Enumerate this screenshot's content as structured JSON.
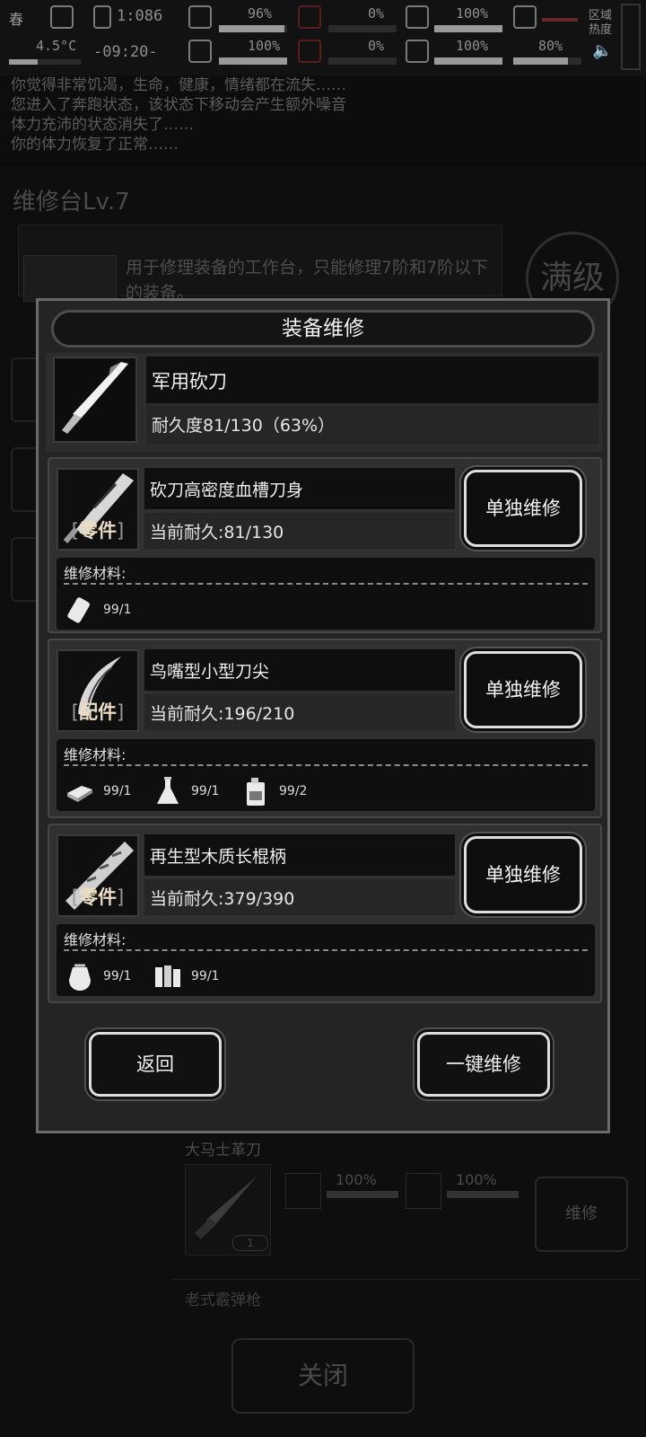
{
  "status_bar": {
    "season": "春",
    "time": "1:086",
    "temperature": "4.5°C",
    "clock": "-09:20-",
    "stat_pcts": [
      "96%",
      "0%",
      "100%",
      "100%",
      "0%",
      "100%",
      "80%"
    ],
    "region_heat_label": "区域热度"
  },
  "log": {
    "lines": [
      "你觉得非常饥渴，生命，健康，情绪都在流失……",
      "您进入了奔跑状态，该状态下移动会产生额外噪音",
      "体力充沛的状态消失了……",
      "你的体力恢复了正常……"
    ]
  },
  "workbench": {
    "title": "维修台Lv.7",
    "description": "用于修理装备的工作台，只能修理7阶和7阶以下的装备。",
    "badge": "满级",
    "bg_item_name": "大马士革刀",
    "bg_pct_a": "100%",
    "bg_pct_b": "100%",
    "bg_item_count": "1",
    "bg_repair_label": "维修",
    "bg_item2_name": "老式霰弹枪",
    "close_label": "关闭"
  },
  "modal": {
    "title": "装备维修",
    "item": {
      "name": "军用砍刀",
      "durability": "耐久度81/130（63%）"
    },
    "materials_label": "维修材料:",
    "parts": [
      {
        "tag": "零件",
        "name": "砍刀高密度血槽刀身",
        "durability": "当前耐久:81/130",
        "button": "单独维修",
        "materials": [
          {
            "icon": "whetstone-icon",
            "qty": "99/1"
          }
        ]
      },
      {
        "tag": "配件",
        "name": "鸟嘴型小型刀尖",
        "durability": "当前耐久:196/210",
        "button": "单独维修",
        "materials": [
          {
            "icon": "metal-bar-icon",
            "qty": "99/1"
          },
          {
            "icon": "flask-icon",
            "qty": "99/1"
          },
          {
            "icon": "jerrycan-icon",
            "qty": "99/2"
          }
        ]
      },
      {
        "tag": "零件",
        "name": "再生型木质长棍柄",
        "durability": "当前耐久:379/390",
        "button": "单独维修",
        "materials": [
          {
            "icon": "resin-pouch-icon",
            "qty": "99/1"
          },
          {
            "icon": "wood-planks-icon",
            "qty": "99/1"
          }
        ]
      }
    ],
    "back_label": "返回",
    "repair_all_label": "一键维修"
  }
}
